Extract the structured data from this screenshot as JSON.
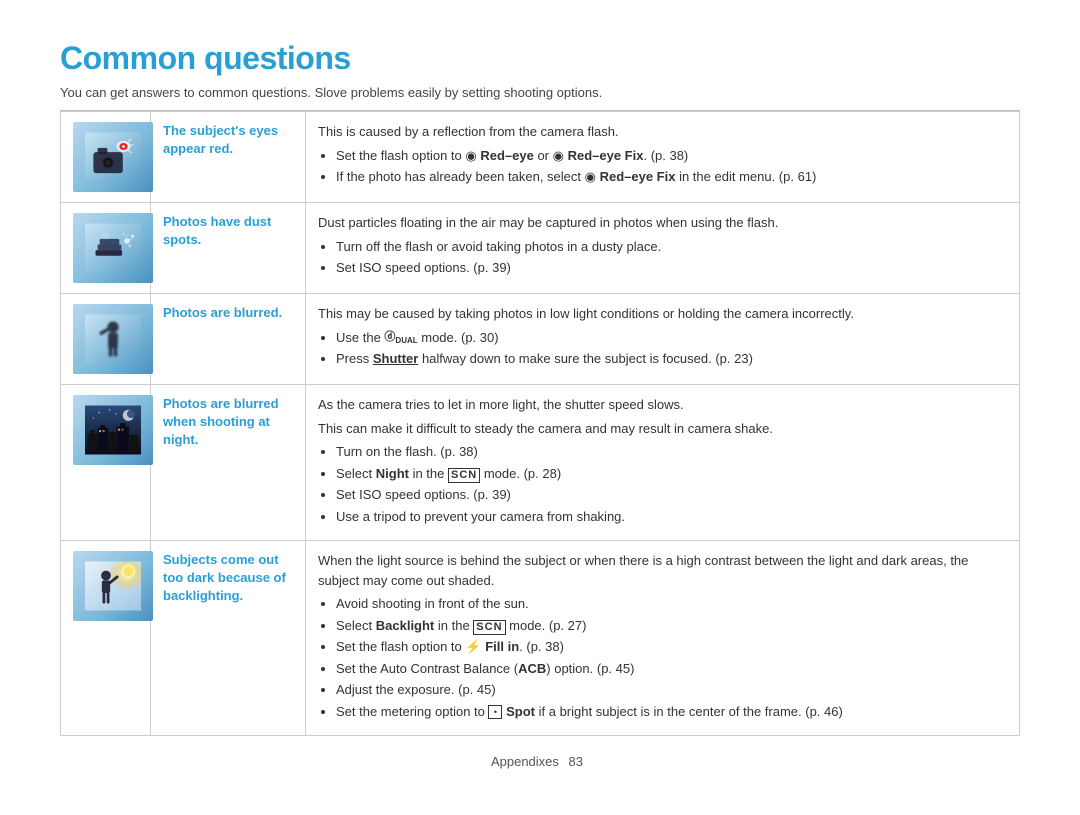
{
  "page": {
    "title": "Common questions",
    "subtitle": "You can get answers to common questions. Slove problems easily by setting shooting options.",
    "footer": "Appendixes",
    "footer_number": "83"
  },
  "rows": [
    {
      "id": "red-eye",
      "label": "The subject's eyes appear red.",
      "description_lines": [
        "This is caused by a reflection from the camera flash."
      ],
      "bullets": [
        "Set the flash option to <redeyeicon/> Red–eye or <fixicon/> Red–eye Fix. (p. 38)",
        "If the photo has already been taken, select <fixicon/> Red–eye Fix in the edit menu. (p. 61)"
      ]
    },
    {
      "id": "dust",
      "label": "Photos have dust spots.",
      "description_lines": [
        "Dust particles floating in the air may be captured in photos when using the flash."
      ],
      "bullets": [
        "Turn off the flash or avoid taking photos in a dusty place.",
        "Set ISO speed options. (p. 39)"
      ]
    },
    {
      "id": "blurred",
      "label": "Photos are blurred.",
      "description_lines": [
        "This may be caused by taking photos in low light conditions or holding the camera incorrectly."
      ],
      "bullets": [
        "Use the <dual/> mode. (p. 30)",
        "Press [Shutter] halfway down to make sure the subject is focused. (p. 23)"
      ]
    },
    {
      "id": "night",
      "label": "Photos are blurred when shooting at night.",
      "description_lines": [
        "As the camera tries to let in more light, the shutter speed slows.",
        "This can make it difficult to steady the camera and may result in camera shake."
      ],
      "bullets": [
        "Turn on the flash. (p. 38)",
        "Select Night in the SCN mode. (p. 28)",
        "Set ISO speed options. (p. 39)",
        "Use a tripod to prevent your camera from shaking."
      ]
    },
    {
      "id": "backlight",
      "label": "Subjects come out too dark because of backlighting.",
      "description_lines": [
        "When the light source is behind the subject or when there is a high contrast between the light and dark areas, the subject may come out shaded."
      ],
      "bullets": [
        "Avoid shooting in front of the sun.",
        "Select Backlight in the SCN mode. (p. 27)",
        "Set the flash option to <fillin/> Fill in. (p. 38)",
        "Set the Auto Contrast Balance (ACB) option. (p. 45)",
        "Adjust the exposure. (p. 45)",
        "Set the metering option to <meter/> Spot if a bright subject is in the center of the frame. (p. 46)"
      ]
    }
  ]
}
